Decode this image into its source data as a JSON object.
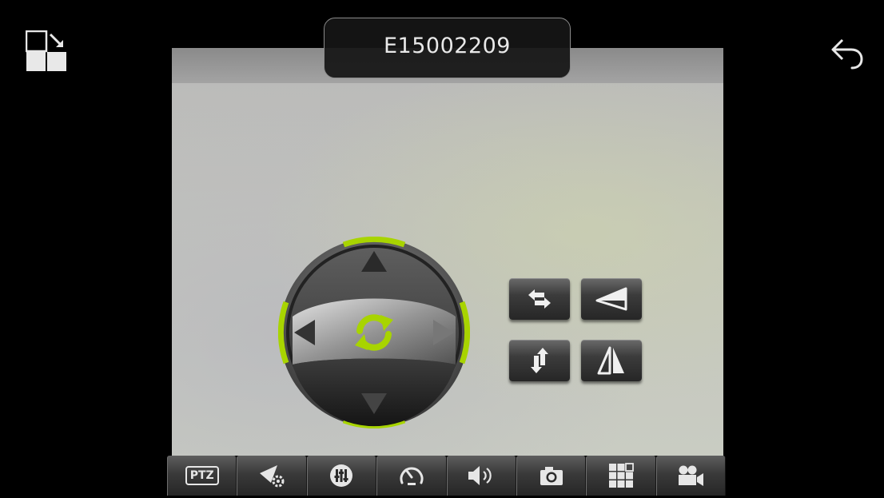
{
  "device": {
    "title": "E15002209"
  },
  "toolbar": {
    "ptz_label": "PTZ",
    "items": [
      {
        "name": "ptz",
        "icon": "ptz-icon"
      },
      {
        "name": "preset",
        "icon": "preset-settings-icon"
      },
      {
        "name": "image-adjust",
        "icon": "equalizer-icon"
      },
      {
        "name": "speed",
        "icon": "speedometer-icon"
      },
      {
        "name": "audio",
        "icon": "speaker-icon"
      },
      {
        "name": "snapshot",
        "icon": "camera-icon"
      },
      {
        "name": "layout",
        "icon": "grid-icon"
      },
      {
        "name": "record",
        "icon": "video-camera-icon"
      }
    ]
  },
  "dpad": {
    "buttons": [
      "up",
      "down",
      "left",
      "right",
      "auto-rotate"
    ],
    "accent_color": "#a8d400"
  },
  "controls": [
    "flip-horizontal",
    "zoom",
    "flip-vertical",
    "mirror"
  ],
  "colors": {
    "background": "#000000",
    "accent": "#a8d400"
  }
}
